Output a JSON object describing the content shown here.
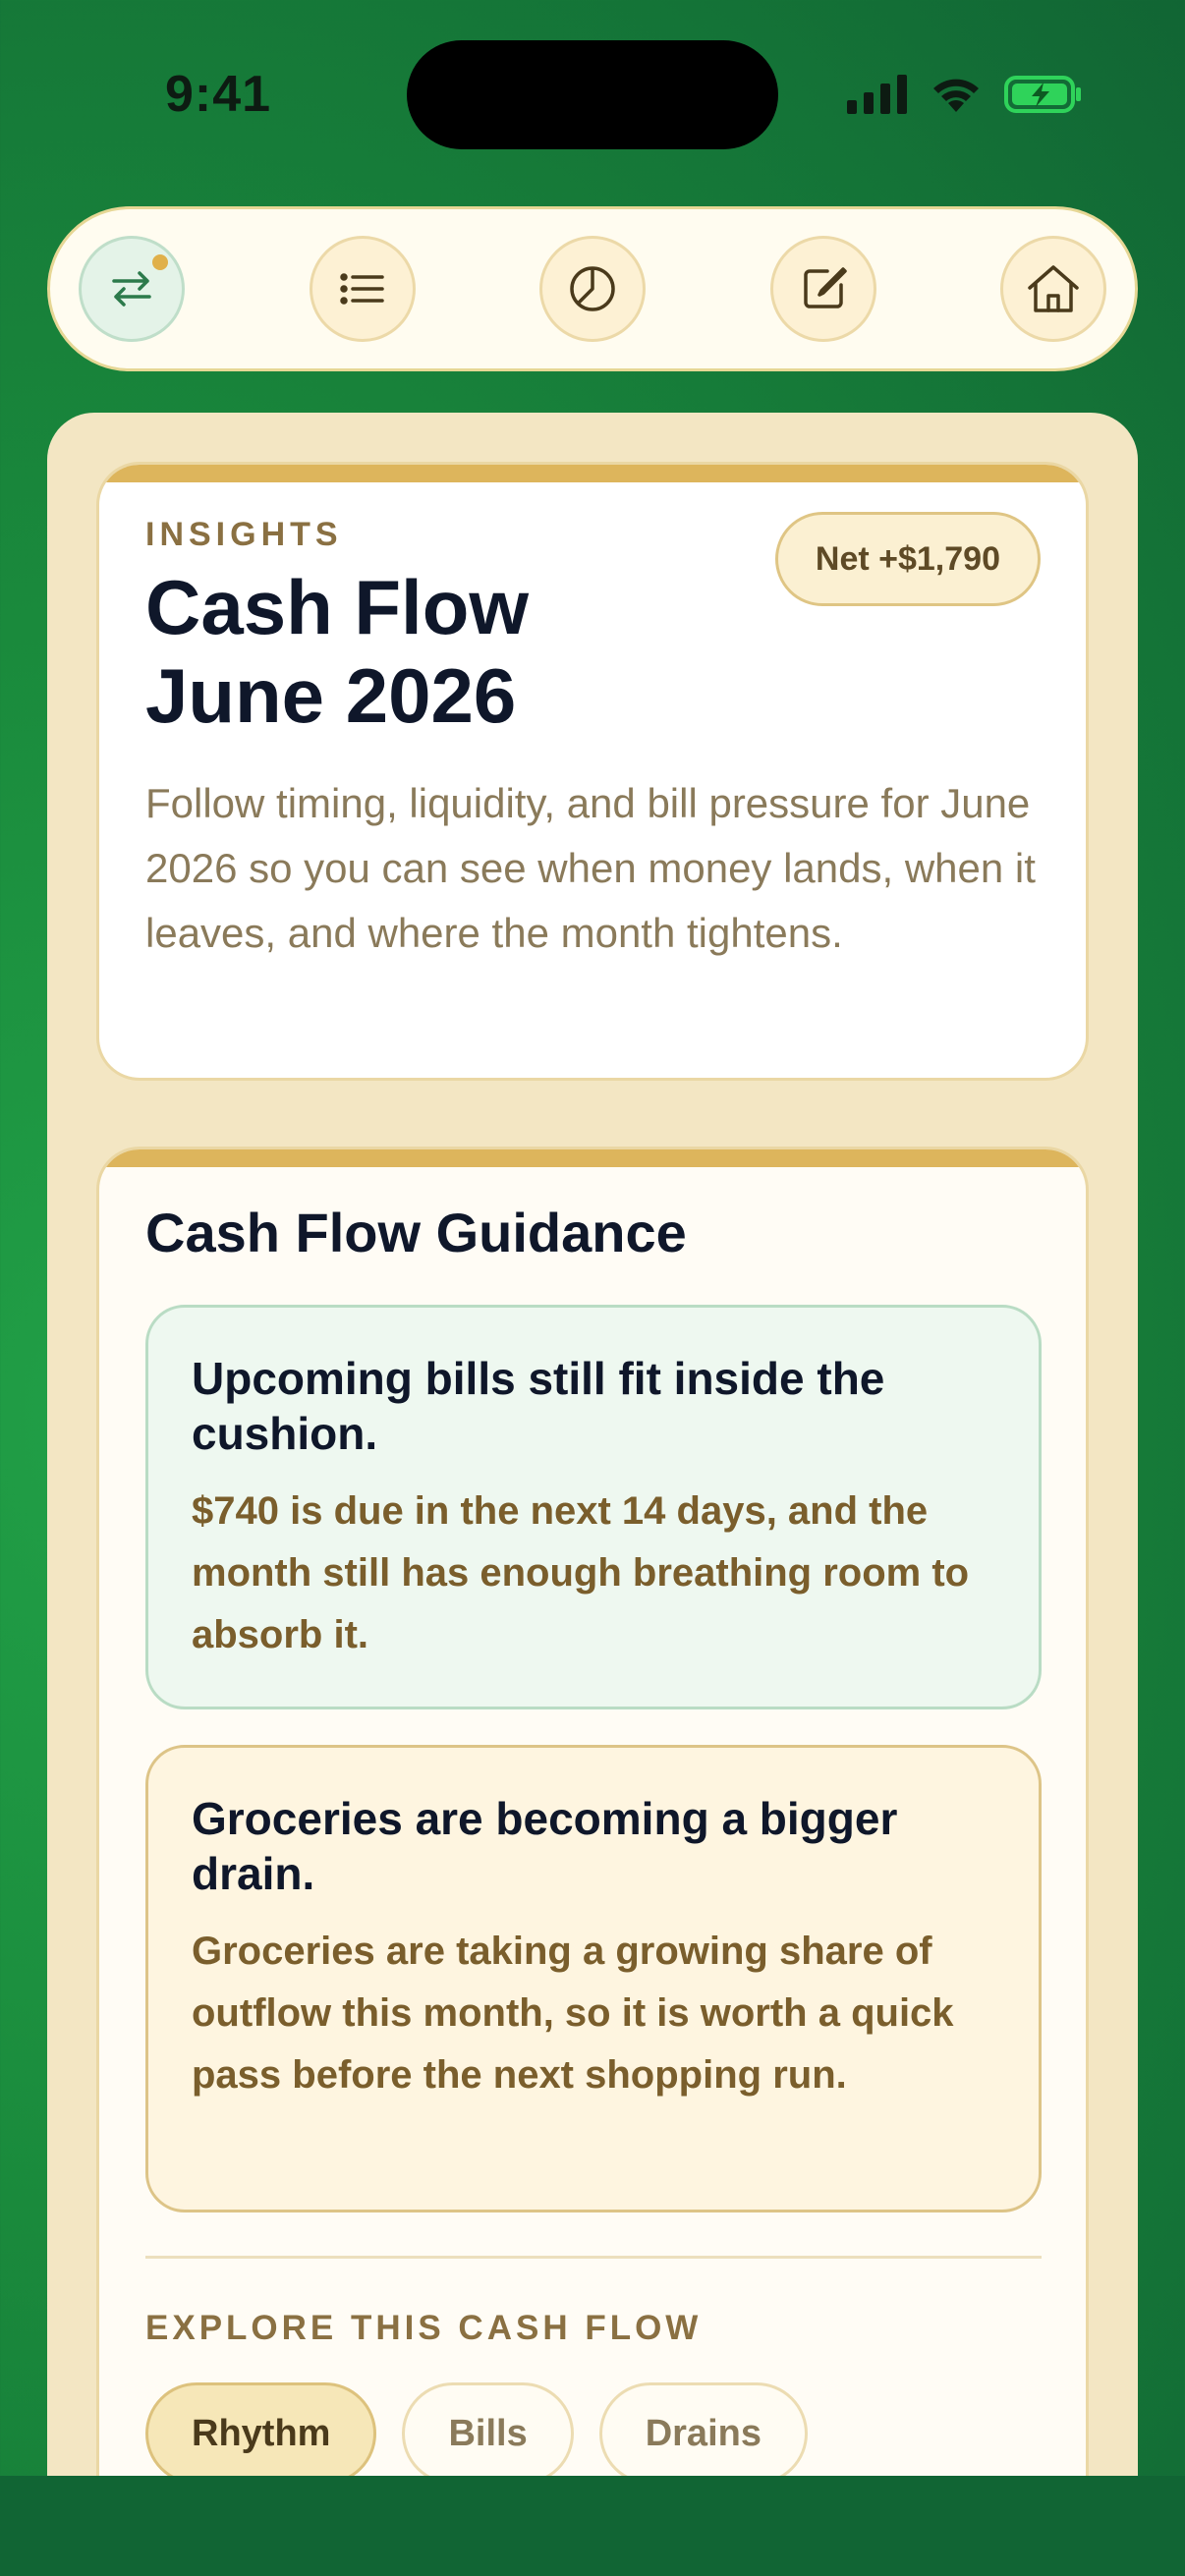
{
  "status_bar": {
    "time": "9:41",
    "battery_color": "#2fd35a"
  },
  "nav": {
    "items": [
      {
        "name": "transfer",
        "icon": "transfer-arrows-icon",
        "active": true,
        "has_badge": true
      },
      {
        "name": "list",
        "icon": "list-icon",
        "active": false
      },
      {
        "name": "insights",
        "icon": "pie-chart-icon",
        "active": false
      },
      {
        "name": "edit",
        "icon": "edit-icon",
        "active": false
      },
      {
        "name": "home",
        "icon": "home-icon",
        "active": false
      }
    ]
  },
  "header_card": {
    "eyebrow": "INSIGHTS",
    "title_line1": "Cash Flow",
    "title_line2": "June 2026",
    "net_badge": "Net +$1,790",
    "description": "Follow timing, liquidity, and bill pressure for June 2026 so you can see when money lands, when it leaves, and where the month tightens."
  },
  "guidance": {
    "title": "Cash Flow Guidance",
    "items": [
      {
        "title": "Upcoming bills still fit inside the cushion.",
        "text": "$740 is due in the next 14 days, and the month still has enough breathing room to absorb it."
      },
      {
        "title": "Groceries are becoming a bigger drain.",
        "text": "Groceries are taking a growing share of outflow this month, so it is worth a quick pass before the next shopping run."
      }
    ],
    "explore_label": "EXPLORE THIS CASH FLOW",
    "chips": [
      "Rhythm",
      "Bills",
      "Drains"
    ],
    "active_chip": "Rhythm"
  },
  "colors": {
    "accent_gold": "#ddb55c",
    "positive_green": "#eef8f0",
    "warning_cream": "#fef5e0",
    "background_green": "#1a8a3c"
  }
}
